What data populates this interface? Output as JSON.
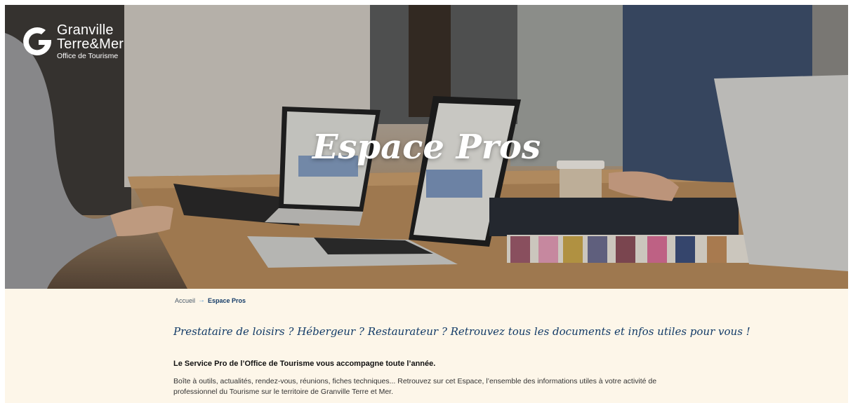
{
  "brand": {
    "line1": "Granville",
    "line2": "Terre&Mer",
    "line3": "Office de Tourisme"
  },
  "hero": {
    "title": "Espace Pros"
  },
  "breadcrumb": {
    "home": "Accueil",
    "current": "Espace Pros"
  },
  "content": {
    "tagline": "Prestataire de loisirs ? Hébergeur ? Restaurateur ? Retrouvez tous les documents et infos utiles pour vous !",
    "intro_bold": "Le Service Pro de l’Office de Tourisme vous accompagne toute l’année.",
    "intro_text": "Boîte à outils, actualités, rendez-vous, réunions, fiches techniques... Retrouvez sur cet Espace, l’ensemble des informations utiles à votre activité de professionnel du Tourisme sur le territoire de Granville Terre et Mer."
  },
  "colors": {
    "navy": "#123a67",
    "cream": "#fdf6e9",
    "accent_arrow": "#5b9ad0"
  }
}
